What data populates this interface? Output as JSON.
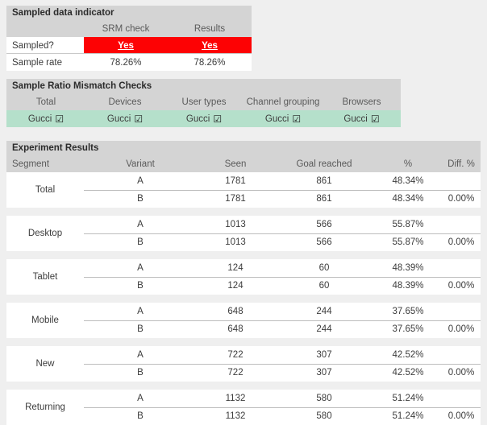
{
  "sampled_data_indicator": {
    "title": "Sampled data indicator",
    "columns": [
      "",
      "SRM check",
      "Results"
    ],
    "rows": [
      {
        "label": "Sampled?",
        "srm_check": "Yes",
        "results": "Yes",
        "highlight": "red"
      },
      {
        "label": "Sample rate",
        "srm_check": "78.26%",
        "results": "78.26%",
        "highlight": "none"
      }
    ],
    "highlight_color": "#fd0204"
  },
  "sample_ratio_mismatch_checks": {
    "title": "Sample Ratio Mismatch Checks",
    "columns": [
      "Total",
      "Devices",
      "User types",
      "Channel grouping",
      "Browsers"
    ],
    "values": [
      "Gucci",
      "Gucci",
      "Gucci",
      "Gucci",
      "Gucci"
    ],
    "check_glyph": "☑",
    "row_color": "#b5e0cb"
  },
  "experiment_results": {
    "title": "Experiment Results",
    "columns": [
      "Segment",
      "Variant",
      "Seen",
      "Goal reached",
      "%",
      "Diff. %"
    ],
    "segments": [
      {
        "segment": "Total",
        "variants": [
          {
            "variant": "A",
            "seen": "1781",
            "goal_reached": "861",
            "pct": "48.34%",
            "diff": ""
          },
          {
            "variant": "B",
            "seen": "1781",
            "goal_reached": "861",
            "pct": "48.34%",
            "diff": "0.00%"
          }
        ]
      },
      {
        "segment": "Desktop",
        "variants": [
          {
            "variant": "A",
            "seen": "1013",
            "goal_reached": "566",
            "pct": "55.87%",
            "diff": ""
          },
          {
            "variant": "B",
            "seen": "1013",
            "goal_reached": "566",
            "pct": "55.87%",
            "diff": "0.00%"
          }
        ]
      },
      {
        "segment": "Tablet",
        "variants": [
          {
            "variant": "A",
            "seen": "124",
            "goal_reached": "60",
            "pct": "48.39%",
            "diff": ""
          },
          {
            "variant": "B",
            "seen": "124",
            "goal_reached": "60",
            "pct": "48.39%",
            "diff": "0.00%"
          }
        ]
      },
      {
        "segment": "Mobile",
        "variants": [
          {
            "variant": "A",
            "seen": "648",
            "goal_reached": "244",
            "pct": "37.65%",
            "diff": ""
          },
          {
            "variant": "B",
            "seen": "648",
            "goal_reached": "244",
            "pct": "37.65%",
            "diff": "0.00%"
          }
        ]
      },
      {
        "segment": "New",
        "variants": [
          {
            "variant": "A",
            "seen": "722",
            "goal_reached": "307",
            "pct": "42.52%",
            "diff": ""
          },
          {
            "variant": "B",
            "seen": "722",
            "goal_reached": "307",
            "pct": "42.52%",
            "diff": "0.00%"
          }
        ]
      },
      {
        "segment": "Returning",
        "variants": [
          {
            "variant": "A",
            "seen": "1132",
            "goal_reached": "580",
            "pct": "51.24%",
            "diff": ""
          },
          {
            "variant": "B",
            "seen": "1132",
            "goal_reached": "580",
            "pct": "51.24%",
            "diff": "0.00%"
          }
        ]
      }
    ]
  }
}
